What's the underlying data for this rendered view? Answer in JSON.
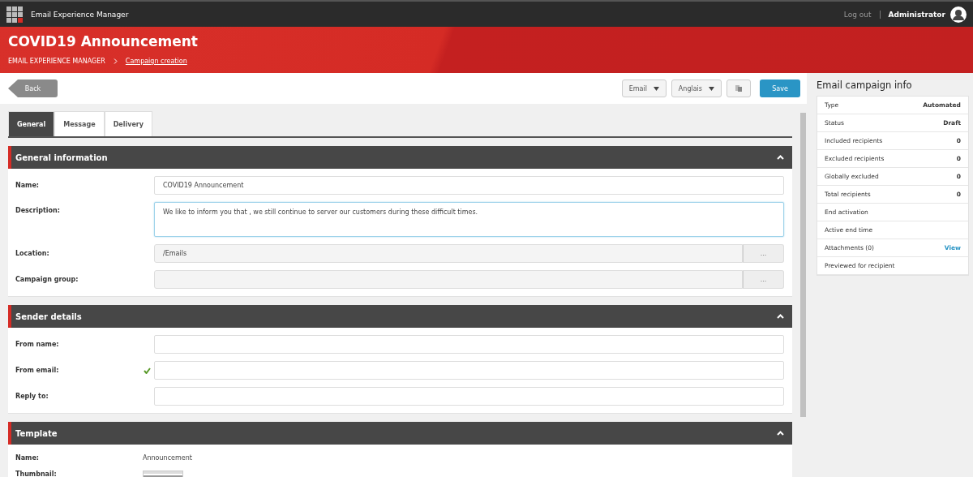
{
  "topbar": {
    "app_name": "Email Experience Manager",
    "logout": "Log out",
    "user": "Administrator"
  },
  "header": {
    "title": "COVID19 Announcement",
    "breadcrumb": [
      {
        "label": "EMAIL EXPERIENCE MANAGER",
        "link": false
      },
      {
        "label": "Campaign creation",
        "link": true
      }
    ]
  },
  "toolbar": {
    "back": "Back",
    "dropdowns": [
      "Email",
      "Anglais"
    ],
    "save": "Save"
  },
  "tabs": [
    {
      "label": "General",
      "selected": true
    },
    {
      "label": "Message",
      "selected": false
    },
    {
      "label": "Delivery",
      "selected": false
    }
  ],
  "sections": [
    {
      "title": "General information",
      "expanded": true,
      "fields": [
        {
          "kind": "text",
          "label": "Name:",
          "value": "COVID19 Announcement"
        },
        {
          "kind": "textarea",
          "label": "Description:",
          "value": "We like to inform you that , we still continue to server our customers during these difficult times.",
          "focused": true
        },
        {
          "kind": "picker",
          "label": "Location:",
          "value": "/Emails",
          "button": "..."
        },
        {
          "kind": "picker",
          "label": "Campaign group:",
          "button": "..."
        }
      ]
    },
    {
      "title": "Sender details",
      "expanded": true,
      "fields": [
        {
          "kind": "text",
          "label": "From name:"
        },
        {
          "kind": "text",
          "label": "From email:",
          "valid": true
        },
        {
          "kind": "text",
          "label": "Reply to:"
        }
      ]
    },
    {
      "title": "Template",
      "expanded": true,
      "fields": [
        {
          "kind": "static",
          "label": "Name:",
          "value": "Announcement"
        },
        {
          "kind": "thumbnail",
          "label": "Thumbnail:"
        }
      ]
    }
  ],
  "info_panel": {
    "title": "Email campaign info",
    "rows": [
      {
        "label": "Type",
        "value": "Automated"
      },
      {
        "label": "Status",
        "value": "Draft"
      },
      {
        "label": "Included recipients",
        "value": "0"
      },
      {
        "label": "Excluded recipients",
        "value": "0"
      },
      {
        "label": "Globally excluded",
        "value": "0"
      },
      {
        "label": "Total recipients",
        "value": "0"
      },
      {
        "label": "End activation"
      },
      {
        "label": "Active end time"
      },
      {
        "label": "Attachments (0)",
        "link": "View"
      },
      {
        "label": "Previewed for recipient"
      }
    ]
  }
}
